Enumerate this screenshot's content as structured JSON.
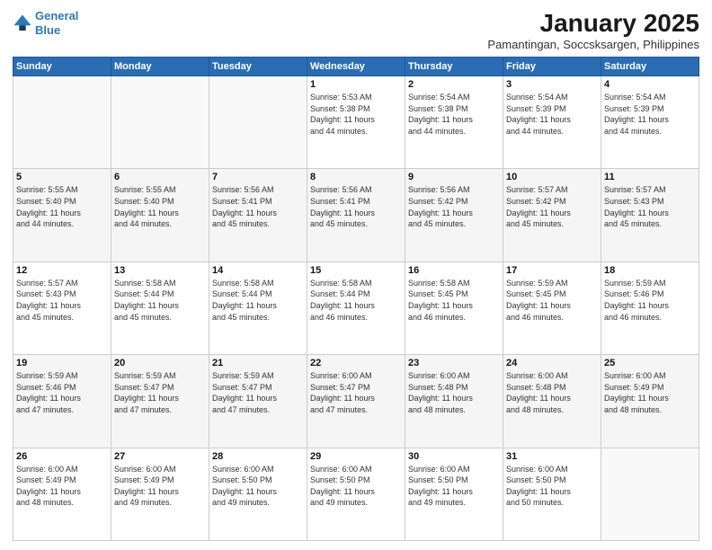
{
  "header": {
    "logo_line1": "General",
    "logo_line2": "Blue",
    "main_title": "January 2025",
    "subtitle": "Pamantingan, Soccsksargen, Philippines"
  },
  "days_of_week": [
    "Sunday",
    "Monday",
    "Tuesday",
    "Wednesday",
    "Thursday",
    "Friday",
    "Saturday"
  ],
  "weeks": [
    [
      {
        "day": "",
        "info": ""
      },
      {
        "day": "",
        "info": ""
      },
      {
        "day": "",
        "info": ""
      },
      {
        "day": "1",
        "info": "Sunrise: 5:53 AM\nSunset: 5:38 PM\nDaylight: 11 hours\nand 44 minutes."
      },
      {
        "day": "2",
        "info": "Sunrise: 5:54 AM\nSunset: 5:38 PM\nDaylight: 11 hours\nand 44 minutes."
      },
      {
        "day": "3",
        "info": "Sunrise: 5:54 AM\nSunset: 5:39 PM\nDaylight: 11 hours\nand 44 minutes."
      },
      {
        "day": "4",
        "info": "Sunrise: 5:54 AM\nSunset: 5:39 PM\nDaylight: 11 hours\nand 44 minutes."
      }
    ],
    [
      {
        "day": "5",
        "info": "Sunrise: 5:55 AM\nSunset: 5:40 PM\nDaylight: 11 hours\nand 44 minutes."
      },
      {
        "day": "6",
        "info": "Sunrise: 5:55 AM\nSunset: 5:40 PM\nDaylight: 11 hours\nand 44 minutes."
      },
      {
        "day": "7",
        "info": "Sunrise: 5:56 AM\nSunset: 5:41 PM\nDaylight: 11 hours\nand 45 minutes."
      },
      {
        "day": "8",
        "info": "Sunrise: 5:56 AM\nSunset: 5:41 PM\nDaylight: 11 hours\nand 45 minutes."
      },
      {
        "day": "9",
        "info": "Sunrise: 5:56 AM\nSunset: 5:42 PM\nDaylight: 11 hours\nand 45 minutes."
      },
      {
        "day": "10",
        "info": "Sunrise: 5:57 AM\nSunset: 5:42 PM\nDaylight: 11 hours\nand 45 minutes."
      },
      {
        "day": "11",
        "info": "Sunrise: 5:57 AM\nSunset: 5:43 PM\nDaylight: 11 hours\nand 45 minutes."
      }
    ],
    [
      {
        "day": "12",
        "info": "Sunrise: 5:57 AM\nSunset: 5:43 PM\nDaylight: 11 hours\nand 45 minutes."
      },
      {
        "day": "13",
        "info": "Sunrise: 5:58 AM\nSunset: 5:44 PM\nDaylight: 11 hours\nand 45 minutes."
      },
      {
        "day": "14",
        "info": "Sunrise: 5:58 AM\nSunset: 5:44 PM\nDaylight: 11 hours\nand 45 minutes."
      },
      {
        "day": "15",
        "info": "Sunrise: 5:58 AM\nSunset: 5:44 PM\nDaylight: 11 hours\nand 46 minutes."
      },
      {
        "day": "16",
        "info": "Sunrise: 5:58 AM\nSunset: 5:45 PM\nDaylight: 11 hours\nand 46 minutes."
      },
      {
        "day": "17",
        "info": "Sunrise: 5:59 AM\nSunset: 5:45 PM\nDaylight: 11 hours\nand 46 minutes."
      },
      {
        "day": "18",
        "info": "Sunrise: 5:59 AM\nSunset: 5:46 PM\nDaylight: 11 hours\nand 46 minutes."
      }
    ],
    [
      {
        "day": "19",
        "info": "Sunrise: 5:59 AM\nSunset: 5:46 PM\nDaylight: 11 hours\nand 47 minutes."
      },
      {
        "day": "20",
        "info": "Sunrise: 5:59 AM\nSunset: 5:47 PM\nDaylight: 11 hours\nand 47 minutes."
      },
      {
        "day": "21",
        "info": "Sunrise: 5:59 AM\nSunset: 5:47 PM\nDaylight: 11 hours\nand 47 minutes."
      },
      {
        "day": "22",
        "info": "Sunrise: 6:00 AM\nSunset: 5:47 PM\nDaylight: 11 hours\nand 47 minutes."
      },
      {
        "day": "23",
        "info": "Sunrise: 6:00 AM\nSunset: 5:48 PM\nDaylight: 11 hours\nand 48 minutes."
      },
      {
        "day": "24",
        "info": "Sunrise: 6:00 AM\nSunset: 5:48 PM\nDaylight: 11 hours\nand 48 minutes."
      },
      {
        "day": "25",
        "info": "Sunrise: 6:00 AM\nSunset: 5:49 PM\nDaylight: 11 hours\nand 48 minutes."
      }
    ],
    [
      {
        "day": "26",
        "info": "Sunrise: 6:00 AM\nSunset: 5:49 PM\nDaylight: 11 hours\nand 48 minutes."
      },
      {
        "day": "27",
        "info": "Sunrise: 6:00 AM\nSunset: 5:49 PM\nDaylight: 11 hours\nand 49 minutes."
      },
      {
        "day": "28",
        "info": "Sunrise: 6:00 AM\nSunset: 5:50 PM\nDaylight: 11 hours\nand 49 minutes."
      },
      {
        "day": "29",
        "info": "Sunrise: 6:00 AM\nSunset: 5:50 PM\nDaylight: 11 hours\nand 49 minutes."
      },
      {
        "day": "30",
        "info": "Sunrise: 6:00 AM\nSunset: 5:50 PM\nDaylight: 11 hours\nand 49 minutes."
      },
      {
        "day": "31",
        "info": "Sunrise: 6:00 AM\nSunset: 5:50 PM\nDaylight: 11 hours\nand 50 minutes."
      },
      {
        "day": "",
        "info": ""
      }
    ]
  ]
}
